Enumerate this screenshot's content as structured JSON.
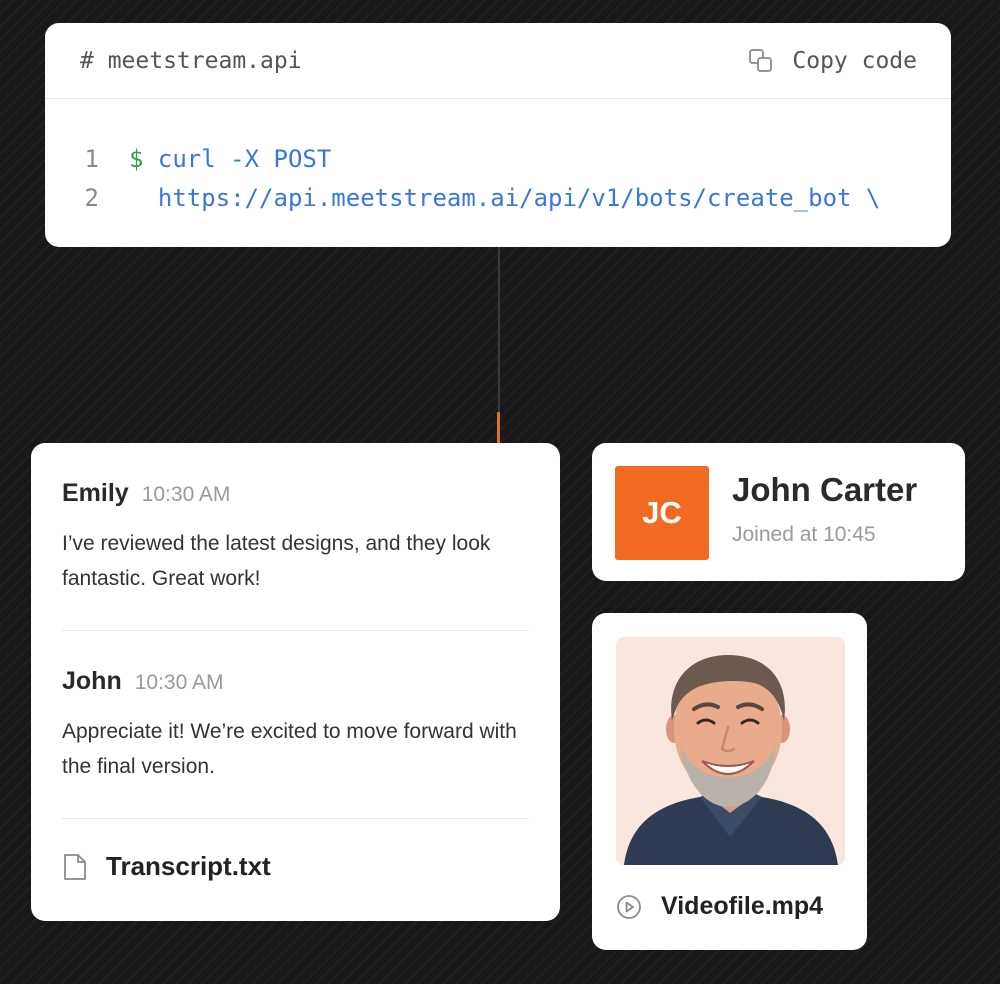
{
  "code_block": {
    "filename": "# meetstream.api",
    "copy_label": "Copy code",
    "lines": [
      {
        "number": "1",
        "prompt": "$",
        "text": "curl -X POST"
      },
      {
        "number": "2",
        "prompt": "",
        "text": "https://api.meetstream.ai/api/v1/bots/create_bot \\"
      }
    ]
  },
  "chat": {
    "messages": [
      {
        "author": "Emily",
        "time": "10:30 AM",
        "text": "I’ve reviewed the latest designs, and they look fantastic. Great work!"
      },
      {
        "author": "John",
        "time": "10:30 AM",
        "text": "Appreciate it! We’re excited to move forward with the final version."
      }
    ],
    "attachment": {
      "icon": "file-icon",
      "label": "Transcript.txt"
    }
  },
  "participant": {
    "initials": "JC",
    "name": "John Carter",
    "status": "Joined at 10:45",
    "avatar_color": "#f26a22"
  },
  "video": {
    "icon": "play-circle-icon",
    "label": "Videofile.mp4"
  },
  "colors": {
    "background": "#181818",
    "accent": "#f26a22",
    "code_blue": "#3a78d8",
    "prompt_green": "#2aa14b",
    "connector_orange": "#e0702f"
  }
}
